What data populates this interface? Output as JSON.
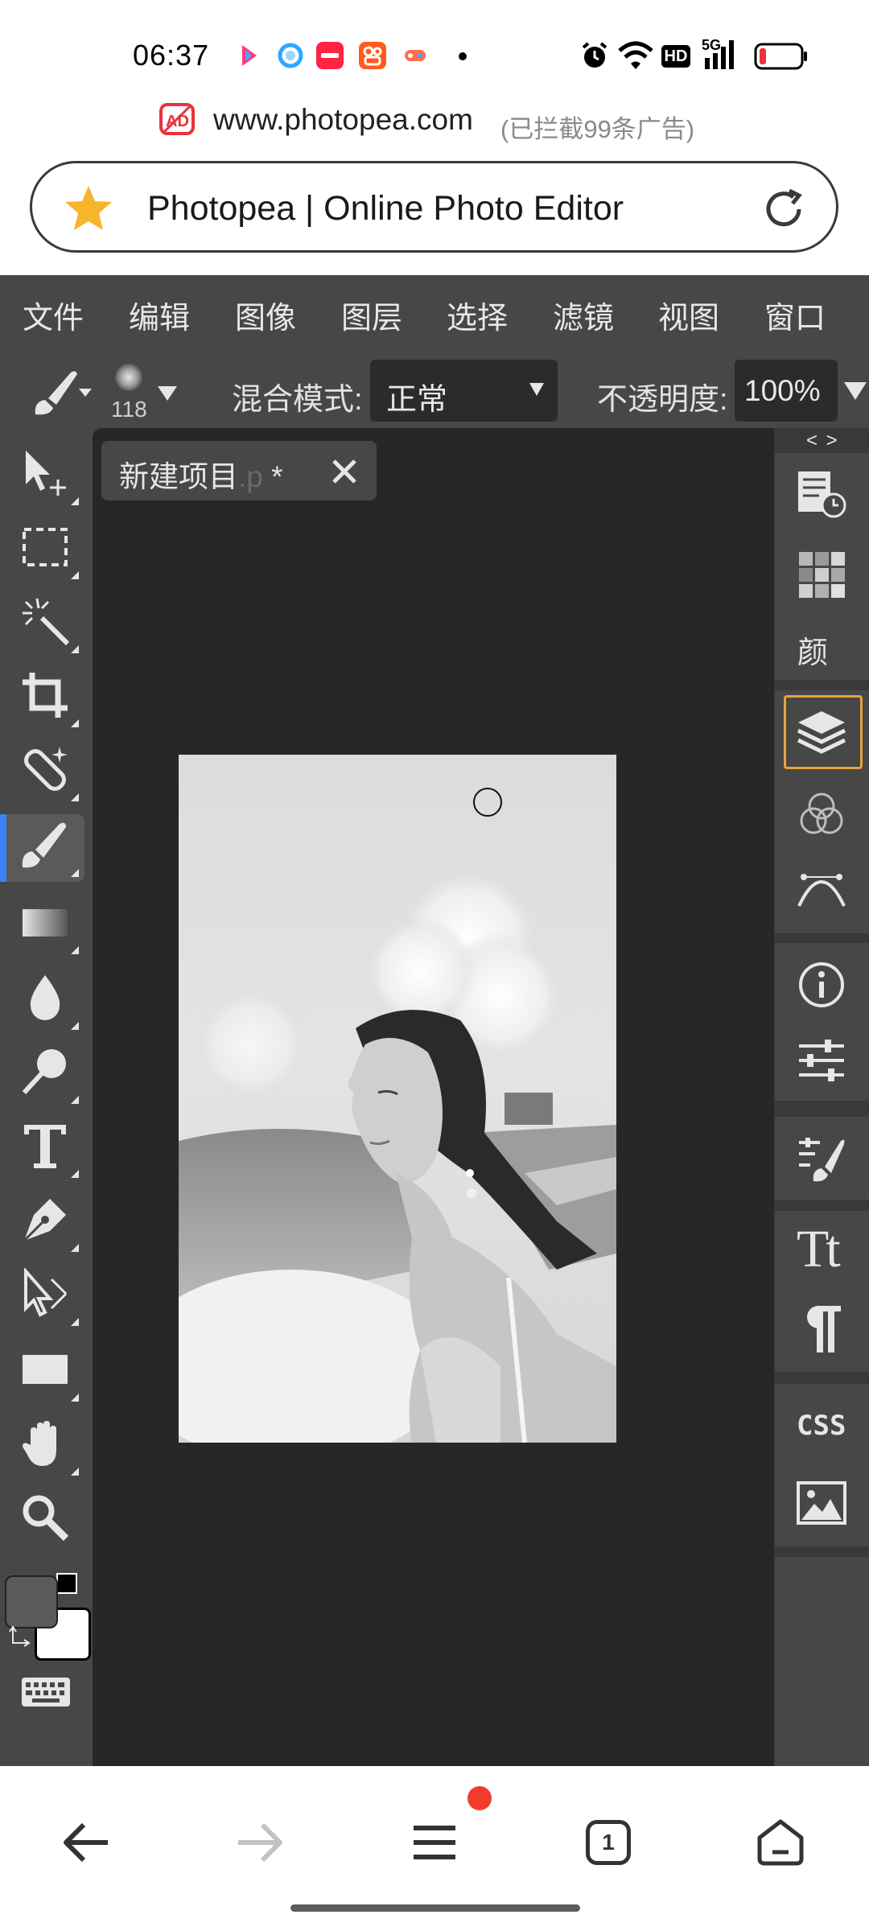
{
  "status_bar": {
    "time": "06:37",
    "app_icons": [
      "bilibili-icon",
      "qq-browser-icon",
      "xiaohongshu-icon",
      "kuaishou-icon",
      "game-center-icon"
    ],
    "system_icons": [
      "alarm-icon",
      "wifi-icon",
      "hd-icon",
      "5g-signal-icon",
      "battery-icon"
    ],
    "network_label": "5G",
    "hd_label": "HD",
    "battery_color": "#e8323c"
  },
  "browser": {
    "domain": "www.photopea.com",
    "blocked_note": "(已拦截99条广告)",
    "ad_badge": "AD",
    "page_title": "Photopea | Online Photo Editor",
    "favorite_color": "#f7b52c"
  },
  "menu": {
    "items": [
      "文件",
      "编辑",
      "图像",
      "图层",
      "选择",
      "滤镜",
      "视图",
      "窗口"
    ]
  },
  "options_bar": {
    "brush_size": "118",
    "blend_label": "混合模式:",
    "blend_value": "正常",
    "opacity_label": "不透明度:",
    "opacity_value": "100%"
  },
  "document_tab": {
    "name": "新建项目",
    "ext": ".p",
    "modified": "*"
  },
  "right_panel": {
    "collapse_label": "< >",
    "color_label": "颜",
    "css_label": "CSS",
    "text_label": "Tt",
    "active_accent": "#e8a33a"
  },
  "left_tools": [
    "move-tool-icon",
    "marquee-tool-icon",
    "magic-wand-tool-icon",
    "crop-tool-icon",
    "healing-tool-icon",
    "brush-tool-icon",
    "gradient-tool-icon",
    "blur-tool-icon",
    "dodge-tool-icon",
    "type-tool-icon",
    "pen-tool-icon",
    "path-select-tool-icon",
    "rectangle-tool-icon",
    "hand-tool-icon",
    "zoom-tool-icon"
  ],
  "colors": {
    "foreground": "#5a5a5a",
    "background": "#ffffff",
    "active_tool_indicator": "#3c82f6"
  },
  "bottom_nav": {
    "tab_count": "1",
    "notification_color": "#f23b2f"
  }
}
